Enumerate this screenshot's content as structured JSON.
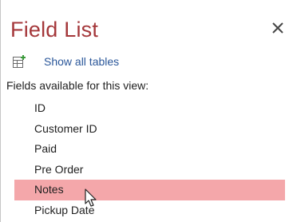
{
  "pane": {
    "title": "Field List",
    "close_icon": "close-icon",
    "show_all_label": "Show all tables",
    "show_all_icon": "table-add-icon",
    "available_label": "Fields available for this view:",
    "fields": [
      {
        "label": "ID"
      },
      {
        "label": "Customer ID"
      },
      {
        "label": "Paid"
      },
      {
        "label": "Pre Order"
      },
      {
        "label": "Notes",
        "state": "hover"
      },
      {
        "label": "Pickup Date"
      }
    ]
  },
  "colors": {
    "title": "#a4373a",
    "link": "#2b579a",
    "hover_row": "#f4a7aa"
  }
}
